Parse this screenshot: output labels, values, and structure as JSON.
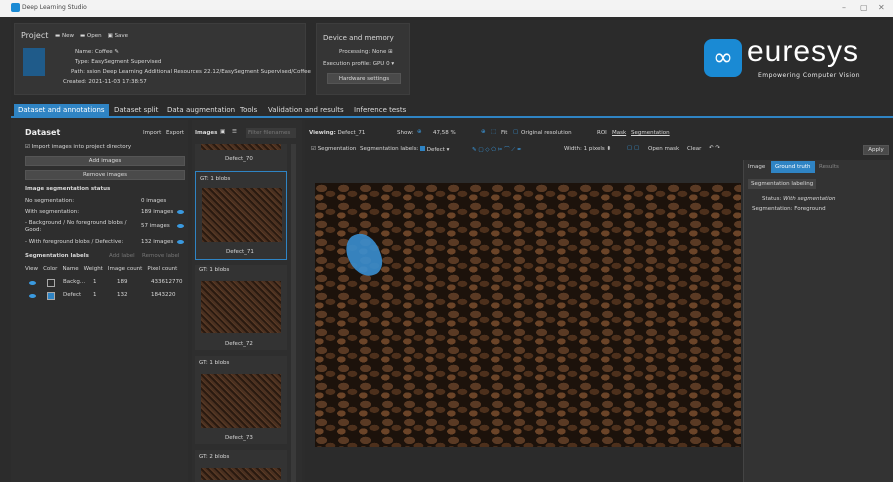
{
  "window": {
    "title": "Deep Learning Studio",
    "minimize": "–",
    "maximize": "▢",
    "close": "✕"
  },
  "project": {
    "header": "Project",
    "new": "New",
    "open": "Open",
    "save": "Save",
    "name_label": "Name:",
    "name": "Coffee",
    "type_label": "Type:",
    "type": "EasySegment Supervised",
    "path_label": "Path:",
    "path": "ssion Deep Learning Additional Resources 22.12/EasySegment Supervised/Coffee",
    "created_label": "Created:",
    "created": "2021-11-03 17:38:57"
  },
  "device": {
    "header": "Device and memory",
    "processing_label": "Processing:",
    "processing": "None",
    "exec_label": "Execution profile:",
    "exec": "GPU 0",
    "hw_button": "Hardware settings"
  },
  "brand": {
    "name": "euresys",
    "tagline": "Empowering Computer Vision"
  },
  "tabs": [
    "Dataset and annotations",
    "Dataset split",
    "Data augmentation",
    "Tools",
    "Validation and results",
    "Inference tests"
  ],
  "dataset": {
    "title": "Dataset",
    "import": "Import",
    "export": "Export",
    "checkbox": "Import images into project directory",
    "add_images": "Add images",
    "remove_images": "Remove images",
    "status_title": "Image segmentation status",
    "rows": [
      {
        "label": "No segmentation:",
        "value": "0 images"
      },
      {
        "label": "With segmentation:",
        "value": "189 images"
      },
      {
        "label": "- Background / No foreground blobs / Good:",
        "value": "57 images"
      },
      {
        "label": "- With foreground blobs / Defective:",
        "value": "132 images"
      }
    ],
    "labels_title": "Segmentation labels",
    "add_label": "Add label",
    "remove_label": "Remove label",
    "columns": [
      "View",
      "Color",
      "Name",
      "Weight",
      "Image count",
      "Pixel count"
    ],
    "label_rows": [
      {
        "name": "Backg...",
        "weight": "1",
        "count": "189",
        "pixels": "433612770",
        "color": "#2c2c2c"
      },
      {
        "name": "Defect",
        "weight": "1",
        "count": "132",
        "pixels": "1843220",
        "color": "#2f84c4"
      }
    ]
  },
  "images": {
    "title": "Images",
    "filter": "Filter filenames",
    "items": [
      {
        "gt": "",
        "name": "Defect_70"
      },
      {
        "gt": "GT: 1 blobs",
        "name": "Defect_71"
      },
      {
        "gt": "GT: 1 blobs",
        "name": "Defect_72"
      },
      {
        "gt": "GT: 1 blobs",
        "name": "Defect_73"
      },
      {
        "gt": "GT: 2 blobs",
        "name": ""
      }
    ]
  },
  "viewer": {
    "viewing_label": "Viewing:",
    "viewing": "Defect_71",
    "show_label": "Show:",
    "zoom": "47,58 %",
    "fit": "Fit",
    "original": "Original resolution",
    "roi": "ROI",
    "mask": "Mask",
    "segmentation": "Segmentation",
    "seg_check": "Segmentation",
    "seg_labels": "Segmentation labels:",
    "seg_label_value": "Defect",
    "width_label": "Width:",
    "width_value": "1 pixels",
    "open_mask": "Open mask",
    "clear": "Clear",
    "apply": "Apply"
  },
  "right": {
    "tabs": [
      "Image",
      "Ground truth",
      "Results"
    ],
    "section": "Segmentation labeling",
    "status_label": "Status:",
    "status": "With segmentation",
    "seg_label": "Segmentation:",
    "seg": "Foreground"
  }
}
